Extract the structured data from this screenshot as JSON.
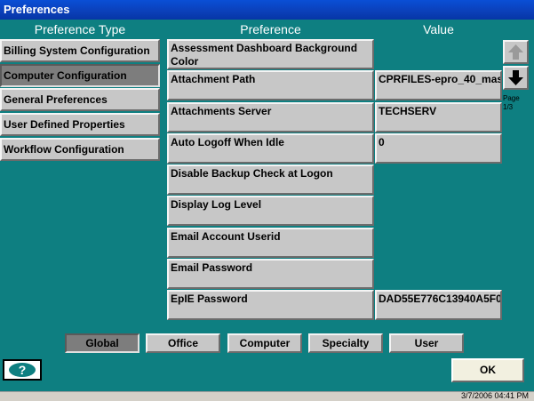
{
  "window": {
    "title": "Preferences"
  },
  "headers": {
    "type": "Preference Type",
    "preference": "Preference",
    "value": "Value"
  },
  "preference_types": [
    {
      "label": "Billing System Configuration",
      "selected": false
    },
    {
      "label": "Computer Configuration",
      "selected": true
    },
    {
      "label": "General Preferences",
      "selected": false
    },
    {
      "label": "User Defined Properties",
      "selected": false
    },
    {
      "label": "Workflow Configuration",
      "selected": false
    }
  ],
  "preferences": [
    {
      "name": "Assessment Dashboard Background Color",
      "value": ""
    },
    {
      "name": "Attachment Path",
      "value": "CPRFILES-epro_40_mas"
    },
    {
      "name": "Attachments Server",
      "value": "TECHSERV"
    },
    {
      "name": "Auto Logoff When Idle",
      "value": "0"
    },
    {
      "name": "Disable Backup Check at Logon",
      "value": ""
    },
    {
      "name": "Display Log Level",
      "value": ""
    },
    {
      "name": "Email Account Userid",
      "value": ""
    },
    {
      "name": "Email Password",
      "value": ""
    },
    {
      "name": "EpIE Password",
      "value": "DAD55E776C13940A5F0"
    }
  ],
  "paging": {
    "label": "Page",
    "position": "1/3",
    "up_icon": "arrow-up-icon",
    "down_icon": "arrow-down-icon"
  },
  "scope_tabs": [
    {
      "label": "Global",
      "selected": true
    },
    {
      "label": "Office",
      "selected": false
    },
    {
      "label": "Computer",
      "selected": false
    },
    {
      "label": "Specialty",
      "selected": false
    },
    {
      "label": "User",
      "selected": false
    }
  ],
  "help": {
    "icon": "help-icon"
  },
  "ok_label": "OK",
  "status": {
    "datetime": "3/7/2006 04:41 PM"
  },
  "colors": {
    "background": "#0e7f81",
    "button": "#c7c7c7",
    "selected": "#7d7d7d"
  }
}
